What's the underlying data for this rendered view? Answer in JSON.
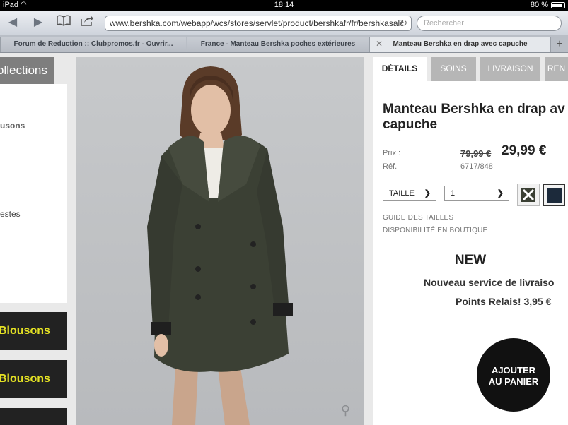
{
  "statusbar": {
    "device": "iPad",
    "time": "18:14",
    "battery": "80 %"
  },
  "toolbar": {
    "url": "www.bershka.com/webapp/wcs/stores/servlet/product/bershkafr/fr/bershkasalc",
    "search_placeholder": "Rechercher"
  },
  "tabs": [
    {
      "label": "Forum de Reduction :: Clubpromos.fr - Ouvrir..."
    },
    {
      "label": "France - Manteau Bershka poches extérieures"
    },
    {
      "label": "Manteau Bershka en drap avec capuche"
    }
  ],
  "sidebar": {
    "collections_label": "ollections",
    "items": [
      {
        "label": "usons"
      },
      {
        "label": "estes"
      }
    ],
    "promos": [
      {
        "label": "Blousons"
      },
      {
        "label": "Blousons"
      }
    ]
  },
  "detail": {
    "tabs": [
      {
        "label": "DÉTAILS"
      },
      {
        "label": "SOINS"
      },
      {
        "label": "LIVRAISON"
      },
      {
        "label": "REN"
      }
    ],
    "title_line1": "Manteau Bershka en drap av",
    "title_line2": "capuche",
    "price_label": "Prix :",
    "old_price": "79,99 €",
    "new_price": "29,99 €",
    "ref_label": "Réf.",
    "ref_value": "6717/848",
    "size_label": "TAILLE",
    "qty_value": "1",
    "size_guide": "GUIDE DES TAILLES",
    "availability": "DISPONIBILITÉ EN BOUTIQUE",
    "new_label": "NEW",
    "delivery_line1": "Nouveau service de livraiso",
    "delivery_line2": "Points Relais! 3,95 €",
    "add_to_cart_line1": "AJOUTER",
    "add_to_cart_line2": "AU PANIER"
  },
  "colors": {
    "promo_text": "#e3e024",
    "coat": "#3b4034"
  },
  "icons": [
    "wifi-icon",
    "battery-icon",
    "back-icon",
    "forward-icon",
    "bookmarks-icon",
    "share-icon",
    "reload-icon",
    "close-icon",
    "new-tab-icon",
    "zoom-icon"
  ]
}
